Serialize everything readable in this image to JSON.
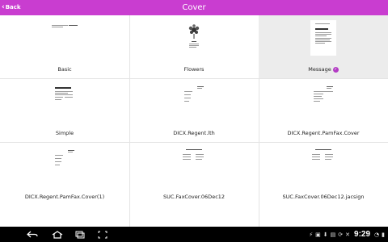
{
  "header": {
    "back_label": "Back",
    "title": "Cover",
    "background": "#c93dd0"
  },
  "covers": [
    {
      "label": "Basic",
      "selected": false
    },
    {
      "label": "Flowers",
      "selected": false
    },
    {
      "label": "Message",
      "selected": true
    },
    {
      "label": "Simple",
      "selected": false
    },
    {
      "label": "DICX.Regent.lth",
      "selected": false
    },
    {
      "label": "DICX.Regent.PamFax.Cover",
      "selected": false
    },
    {
      "label": "DICX.Regent.PamFax.Cover(1)",
      "selected": false
    },
    {
      "label": "SUC.FaxCover.06Dec12",
      "selected": false
    },
    {
      "label": "SUC.FaxCover.06Dec12.jacsign",
      "selected": false
    }
  ],
  "accent_color": "#b33bc4",
  "status_bar": {
    "time": "9:29",
    "icons": [
      "usb-icon",
      "screenshot-icon",
      "download-icon",
      "notification-icon",
      "sync-icon",
      "mute-icon",
      "wifi-icon",
      "battery-icon"
    ]
  },
  "nav_bar": {
    "icons": [
      "back-nav-icon",
      "home-nav-icon",
      "recent-apps-icon",
      "screenshot-capture-icon"
    ]
  }
}
